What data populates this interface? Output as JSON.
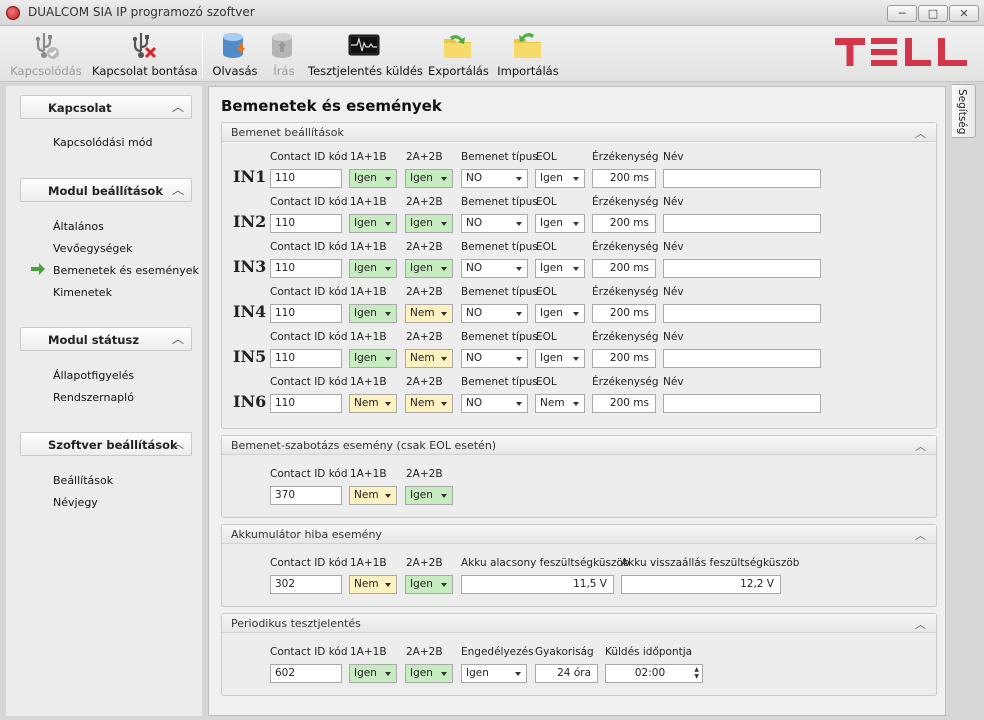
{
  "window": {
    "title": "DUALCOM SIA IP programozó szoftver",
    "min": "─",
    "max": "□",
    "close": "✕"
  },
  "toolbar": {
    "connect": "Kapcsolódás",
    "disconnect": "Kapcsolat bontása",
    "read": "Olvasás",
    "write": "Írás",
    "test_report": "Tesztjelentés küldés",
    "export": "Exportálás",
    "import": "Importálás"
  },
  "brand": {
    "logo": "TELL",
    "color": "#d2364b"
  },
  "help_tab": "Segítség",
  "sidebar": {
    "sections": [
      {
        "title": "Kapcsolat",
        "items": [
          "Kapcsolódási mód"
        ]
      },
      {
        "title": "Modul beállítások",
        "items": [
          "Általános",
          "Vevőegységek",
          "Bemenetek és események",
          "Kimenetek"
        ]
      },
      {
        "title": "Modul státusz",
        "items": [
          "Állapotfigyelés",
          "Rendszernapló"
        ]
      },
      {
        "title": "Szoftver beállítások",
        "items": [
          "Beállítások",
          "Névjegy"
        ]
      }
    ],
    "active_item": "Bemenetek és események"
  },
  "page_title": "Bemenetek és események",
  "inputs_group": {
    "title": "Bemenet beállítások",
    "headers": {
      "cid": "Contact ID kód",
      "a": "1A+1B",
      "b": "2A+2B",
      "type": "Bemenet típus",
      "eol": "EOL",
      "sens": "Érzékenység",
      "name": "Név"
    },
    "rows": [
      {
        "label": "IN1",
        "cid": "110",
        "a": "Igen",
        "b": "Igen",
        "type": "NO",
        "eol": "Igen",
        "sens": "200 ms",
        "name": ""
      },
      {
        "label": "IN2",
        "cid": "110",
        "a": "Igen",
        "b": "Igen",
        "type": "NO",
        "eol": "Igen",
        "sens": "200 ms",
        "name": ""
      },
      {
        "label": "IN3",
        "cid": "110",
        "a": "Igen",
        "b": "Igen",
        "type": "NO",
        "eol": "Igen",
        "sens": "200 ms",
        "name": ""
      },
      {
        "label": "IN4",
        "cid": "110",
        "a": "Igen",
        "b": "Nem",
        "type": "NO",
        "eol": "Igen",
        "sens": "200 ms",
        "name": ""
      },
      {
        "label": "IN5",
        "cid": "110",
        "a": "Igen",
        "b": "Nem",
        "type": "NO",
        "eol": "Igen",
        "sens": "200 ms",
        "name": ""
      },
      {
        "label": "IN6",
        "cid": "110",
        "a": "Nem",
        "b": "Nem",
        "type": "NO",
        "eol": "Nem",
        "sens": "200 ms",
        "name": ""
      }
    ]
  },
  "sabotage_group": {
    "title": "Bemenet-szabotázs esemény (csak EOL esetén)",
    "cid_label": "Contact ID kód",
    "a_label": "1A+1B",
    "b_label": "2A+2B",
    "cid": "370",
    "a": "Nem",
    "b": "Igen"
  },
  "battery_group": {
    "title": "Akkumulátor hiba esemény",
    "cid_label": "Contact ID kód",
    "a_label": "1A+1B",
    "b_label": "2A+2B",
    "low_label": "Akku alacsony feszültségküszöb",
    "restore_label": "Akku visszaállás feszültségküszöb",
    "cid": "302",
    "a": "Nem",
    "b": "Igen",
    "low": "11,5 V",
    "restore": "12,2 V"
  },
  "periodic_group": {
    "title": "Periodikus tesztjelentés",
    "cid_label": "Contact ID kód",
    "a_label": "1A+1B",
    "b_label": "2A+2B",
    "enable_label": "Engedélyezés",
    "freq_label": "Gyakoriság",
    "time_label": "Küldés időpontja",
    "cid": "602",
    "a": "Igen",
    "b": "Igen",
    "enable": "Igen",
    "freq": "24 óra",
    "time": "02:00"
  },
  "colors": {
    "yes_bg": "#c8ecc1",
    "no_bg": "#fdf1c2",
    "arrow": "#4aa33a"
  }
}
